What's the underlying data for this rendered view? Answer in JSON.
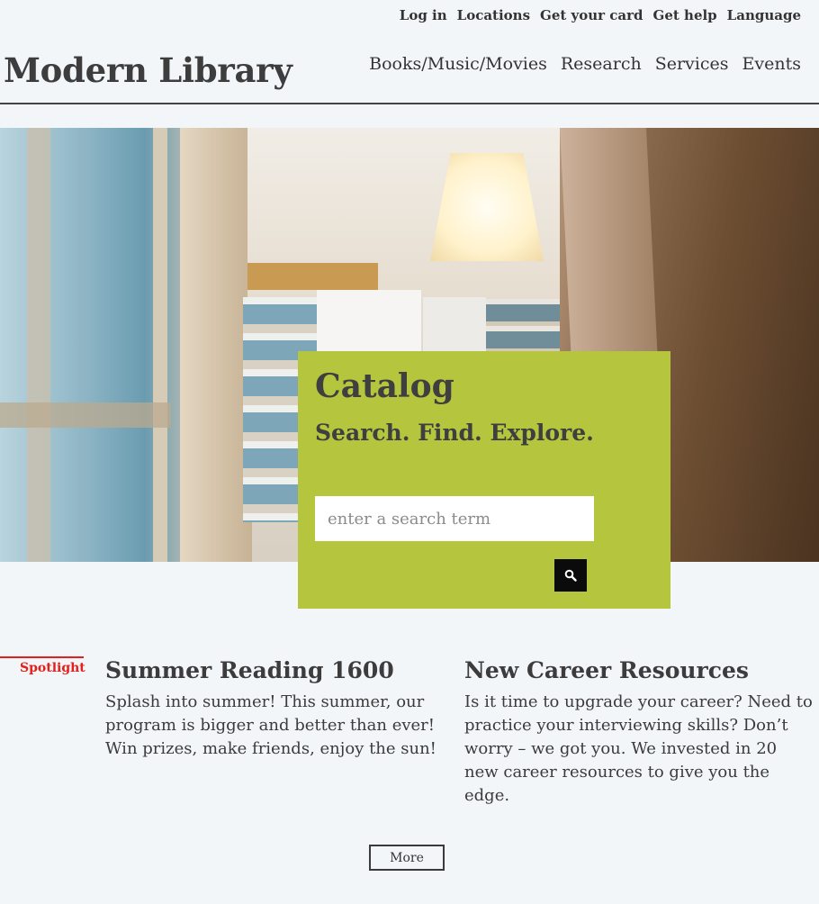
{
  "utility_nav": {
    "items": [
      "Log in",
      "Locations",
      "Get your card",
      "Get help",
      "Language"
    ]
  },
  "site": {
    "title": "Modern Library"
  },
  "main_nav": {
    "items": [
      "Books/Music/Movies",
      "Research",
      "Services",
      "Events"
    ]
  },
  "catalog": {
    "title": "Catalog",
    "subtitle": "Search. Find. Explore.",
    "search_placeholder": "enter a search term",
    "search_value": "",
    "search_button_icon": "search-icon",
    "box_color": "#b5c63e"
  },
  "spotlight": {
    "label": "Spotlight",
    "accent_color": "#e3201a",
    "articles": [
      {
        "title": "Summer Reading 1600",
        "body": "Splash into summer! This summer, our program is bigger and better than ever! Win prizes, make friends, enjoy the sun!"
      },
      {
        "title": "New Career Resources",
        "body": "Is it time to upgrade your career? Need to practice your interviewing skills? Don’t worry – we got you. We invested in 20 new career resources to give you the edge."
      }
    ],
    "more_label": "More"
  }
}
